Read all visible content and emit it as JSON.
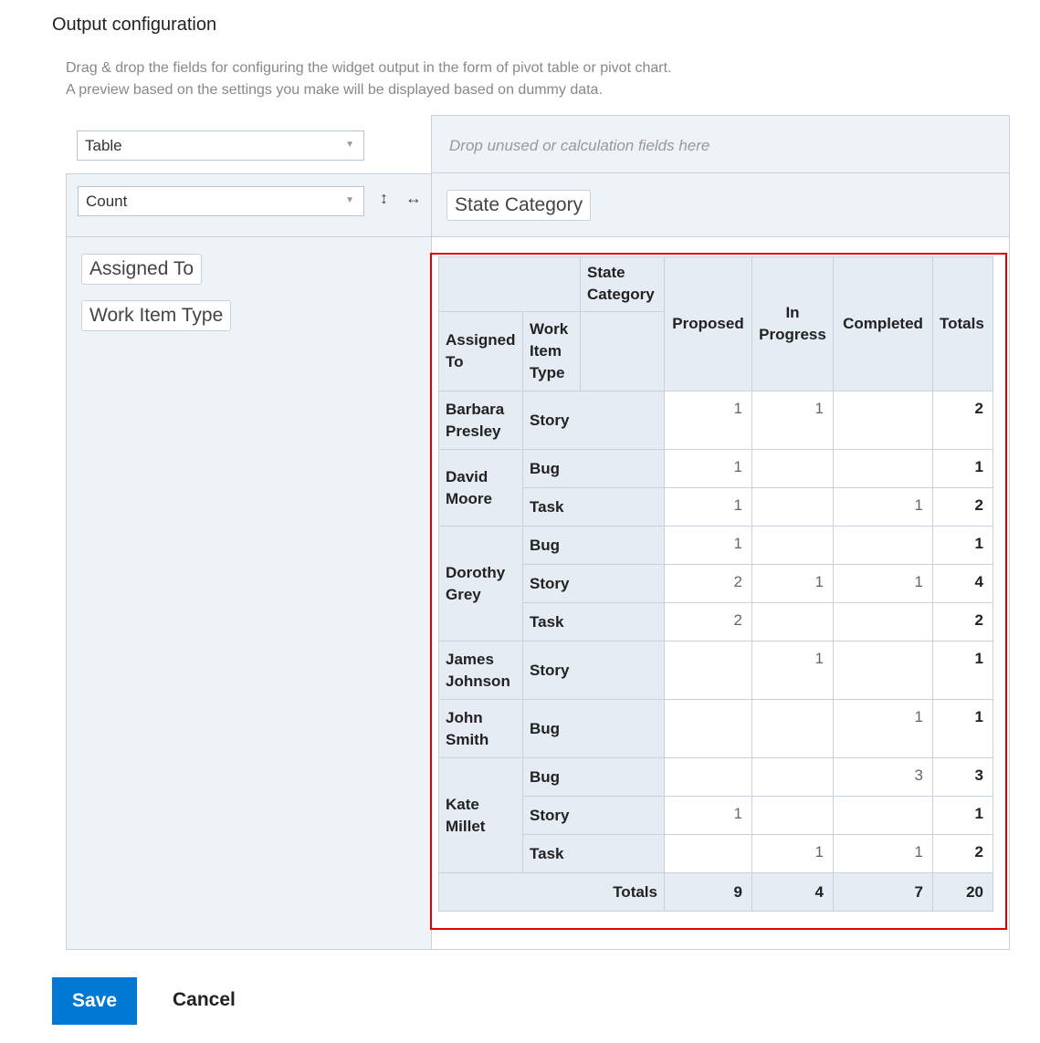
{
  "section": {
    "title": "Output configuration",
    "description_line1": "Drag & drop the fields for configuring the widget output in the form of pivot table or pivot chart.",
    "description_line2": "A preview based on the settings you make will be displayed based on dummy data."
  },
  "config": {
    "view_select_value": "Table",
    "aggregation_select_value": "Count",
    "drop_hint": "Drop unused or calculation fields here",
    "column_field_chips": [
      "State Category"
    ],
    "row_field_chips": [
      "Assigned To",
      "Work Item Type"
    ],
    "icons": {
      "vertical": "vertical-arrows-icon",
      "horizontal": "horizontal-arrows-icon",
      "caret": "chevron-down-icon"
    }
  },
  "pivot": {
    "column_field_label": "State Category",
    "row_field_labels": [
      "Assigned To",
      "Work Item Type"
    ],
    "columns": [
      "Proposed",
      "In Progress",
      "Completed",
      "Totals"
    ],
    "rows": [
      {
        "assignee": "Barbara Presley",
        "type": "Story",
        "values": [
          "1",
          "1",
          "",
          "2"
        ]
      },
      {
        "assignee": "David Moore",
        "type": "Bug",
        "values": [
          "1",
          "",
          "",
          "1"
        ]
      },
      {
        "assignee": "",
        "type": "Task",
        "values": [
          "1",
          "",
          "1",
          "2"
        ]
      },
      {
        "assignee": "Dorothy Grey",
        "type": "Bug",
        "values": [
          "1",
          "",
          "",
          "1"
        ]
      },
      {
        "assignee": "",
        "type": "Story",
        "values": [
          "2",
          "1",
          "1",
          "4"
        ]
      },
      {
        "assignee": "",
        "type": "Task",
        "values": [
          "2",
          "",
          "",
          "2"
        ]
      },
      {
        "assignee": "James Johnson",
        "type": "Story",
        "values": [
          "",
          "1",
          "",
          "1"
        ]
      },
      {
        "assignee": "John Smith",
        "type": "Bug",
        "values": [
          "",
          "",
          "1",
          "1"
        ]
      },
      {
        "assignee": "Kate Millet",
        "type": "Bug",
        "values": [
          "",
          "",
          "3",
          "3"
        ]
      },
      {
        "assignee": "",
        "type": "Story",
        "values": [
          "1",
          "",
          "",
          "1"
        ]
      },
      {
        "assignee": "",
        "type": "Task",
        "values": [
          "",
          "1",
          "1",
          "2"
        ]
      }
    ],
    "totals_label": "Totals",
    "totals": [
      "9",
      "4",
      "7",
      "20"
    ]
  },
  "actions": {
    "save_label": "Save",
    "cancel_label": "Cancel"
  },
  "colors": {
    "accent": "#0078d4",
    "highlight": "#e00000",
    "header_bg": "#e6ecf4",
    "panel_bg": "#eef3f8"
  }
}
